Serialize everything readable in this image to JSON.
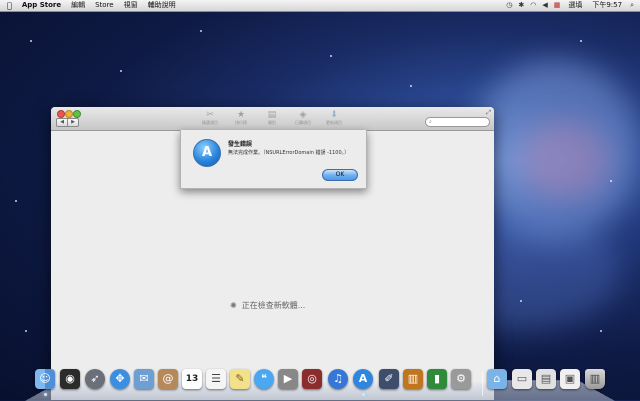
{
  "menubar": {
    "apple_icon": "",
    "app_name": "App Store",
    "menus": [
      "編輯",
      "Store",
      "視窗",
      "輔助說明"
    ],
    "input_method": "選填",
    "clock": "下午9:57",
    "status_icons": [
      "time-machine-icon",
      "bluetooth-icon",
      "wifi-icon",
      "volume-icon",
      "flag-icon",
      "spotlight-icon"
    ]
  },
  "window": {
    "toolbar": [
      "精選項目",
      "排行榜",
      "類別",
      "已購項目",
      "更新項目"
    ],
    "search_placeholder": "",
    "loading_text": "正在檢查新軟體..."
  },
  "alert": {
    "title": "發生錯誤",
    "message": "無法完成作業。（NSURLErrorDomain 錯誤 -1100。）",
    "ok_label": "OK"
  },
  "dock": {
    "calendar_day": "13",
    "apps": [
      "finder-icon",
      "dashboard-icon",
      "launchpad-icon",
      "safari-icon",
      "mail-icon",
      "contacts-icon",
      "calendar-icon",
      "reminders-icon",
      "notes-icon",
      "messages-icon",
      "facetime-icon",
      "photo-booth-icon",
      "itunes-icon",
      "app-store-icon",
      "preview-icon",
      "ibooks-icon",
      "numbers-icon",
      "system-preferences-icon"
    ],
    "stacks": [
      "applications-folder-icon",
      "downloads-stack-icon",
      "documents-stack-icon",
      "screenshot-stack-icon",
      "trash-icon"
    ]
  }
}
